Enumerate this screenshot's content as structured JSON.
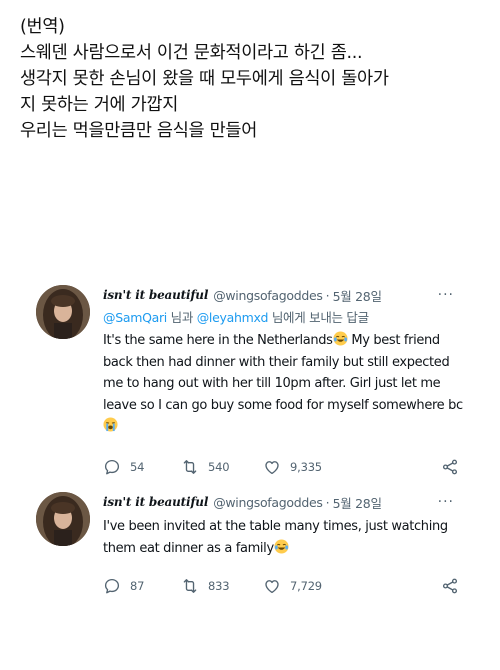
{
  "translation": {
    "lines": [
      "(번역)",
      "스웨덴 사람으로서 이건 문화적이라고 하긴 좀...",
      "생각지 못한 손님이 왔을 때 모두에게 음식이 돌아가",
      "지 못하는 거에 가깝지",
      "우리는 먹을만큼만 음식을 만들어"
    ]
  },
  "tweets": [
    {
      "display_name": "isn't it beautiful",
      "handle": "@wingsofagoddes",
      "separator": "·",
      "date": "5월 28일",
      "more": "···",
      "reply_to": {
        "mention1": "@SamQari",
        "joiner": " 님과 ",
        "mention2": "@leyahmxd",
        "suffix": " 님에게 보내는 답글"
      },
      "text_lines": [
        "It's the same here in the Netherlands",
        "back then had dinner with their family but still expected",
        "me to hang out with her till 10pm after. Girl just let me",
        "leave so I can go buy some food for myself somewhere bc"
      ],
      "text_line1_after_emoji": " My best friend",
      "emoji": "crying-laughing, loudly-crying",
      "replies": "54",
      "retweets": "540",
      "likes": "9,335"
    },
    {
      "display_name": "isn't it beautiful",
      "handle": "@wingsofagoddes",
      "separator": "·",
      "date": "5월 28일",
      "more": "···",
      "text_lines": [
        "I've been invited at the table many times, just watching",
        "them eat dinner as a family"
      ],
      "emoji": "crying-laughing",
      "replies": "87",
      "retweets": "833",
      "likes": "7,729"
    }
  ],
  "colors": {
    "text": "#0f1419",
    "secondary": "#536471",
    "mention": "#1d9bf0",
    "emoji_face": "#ffcc4d"
  },
  "icons": [
    "reply-icon",
    "retweet-icon",
    "like-icon",
    "share-icon",
    "more-icon",
    "avatar"
  ]
}
